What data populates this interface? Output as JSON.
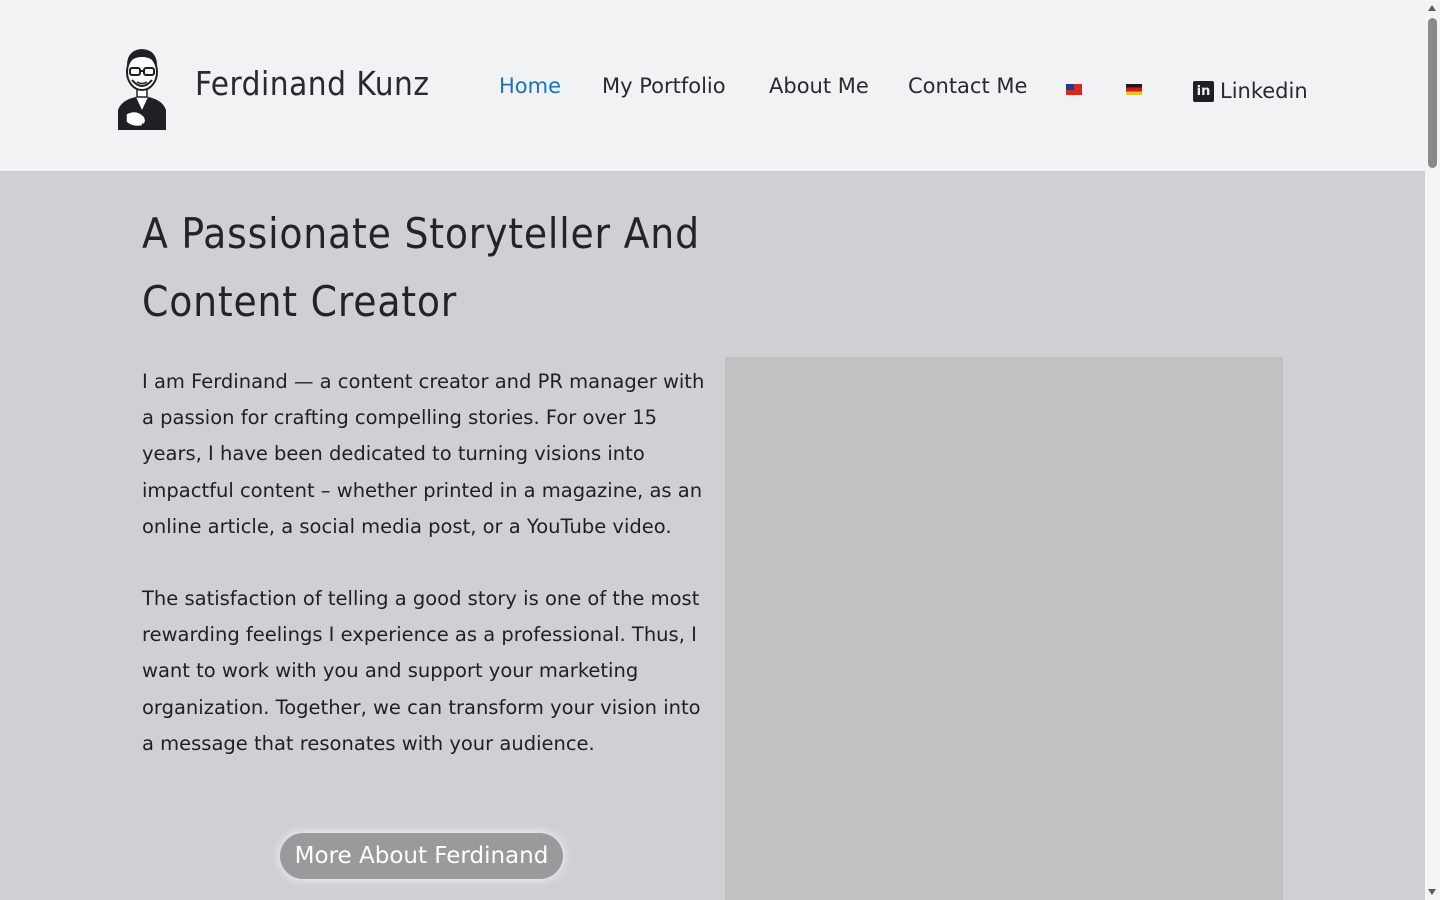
{
  "header": {
    "site_title": "Ferdinand Kunz",
    "nav": [
      {
        "label": "Home",
        "active": true
      },
      {
        "label": "My Portfolio"
      },
      {
        "label": "About Me"
      },
      {
        "label": "Contact Me"
      }
    ],
    "languages": [
      {
        "icon": "taiwan-flag-icon"
      },
      {
        "icon": "germany-flag-icon"
      }
    ],
    "social": {
      "label": "Linkedin",
      "icon": "linkedin-icon"
    }
  },
  "hero": {
    "title": "A Passionate Storyteller And Content Creator",
    "paragraphs": [
      "I am Ferdinand — a content creator and PR manager with a passion for crafting compelling stories. For over 15 years, I have been dedicated to turning visions into impactful content – whether printed in a magazine, as an online article, a social media post, or a YouTube video.",
      "The satisfaction of telling a good story is one of the most rewarding feelings I experience as a professional. Thus, I want to work with you and support your marketing organization. Together, we can transform your vision into a message that resonates with your audience."
    ],
    "cta_label": "More About Ferdinand"
  },
  "colors": {
    "accent": "#1a73b8",
    "header_bg": "#f1f2f4",
    "page_bg": "#cfd0d4",
    "button_bg": "#9a9a9c"
  }
}
